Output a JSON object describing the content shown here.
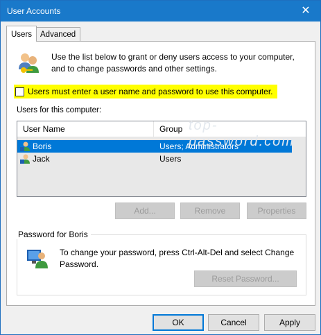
{
  "window": {
    "title": "User Accounts"
  },
  "tabs": [
    {
      "label": "Users",
      "active": true
    },
    {
      "label": "Advanced",
      "active": false
    }
  ],
  "intro_text": "Use the list below to grant or deny users access to your computer, and to change passwords and other settings.",
  "require_login": {
    "label": "Users must enter a user name and password to use this computer.",
    "checked": false
  },
  "users_label": "Users for this computer:",
  "table": {
    "columns": [
      "User Name",
      "Group"
    ],
    "rows": [
      {
        "name": "Boris",
        "group": "Users; Administrators",
        "selected": true
      },
      {
        "name": "Jack",
        "group": "Users",
        "selected": false
      }
    ]
  },
  "watermark": "top-password.com",
  "list_buttons": {
    "add": "Add...",
    "remove": "Remove",
    "properties": "Properties"
  },
  "password_group": {
    "title": "Password for Boris",
    "text": "To change your password, press Ctrl-Alt-Del and select Change Password.",
    "reset": "Reset Password..."
  },
  "dialog_buttons": {
    "ok": "OK",
    "cancel": "Cancel",
    "apply": "Apply"
  },
  "colors": {
    "accent": "#0078d7",
    "titlebar": "#1979ca",
    "highlight": "#ffff00"
  },
  "icons": {
    "close": "close-icon",
    "users": "users-icon",
    "user": "user-icon",
    "password": "password-user-icon"
  }
}
